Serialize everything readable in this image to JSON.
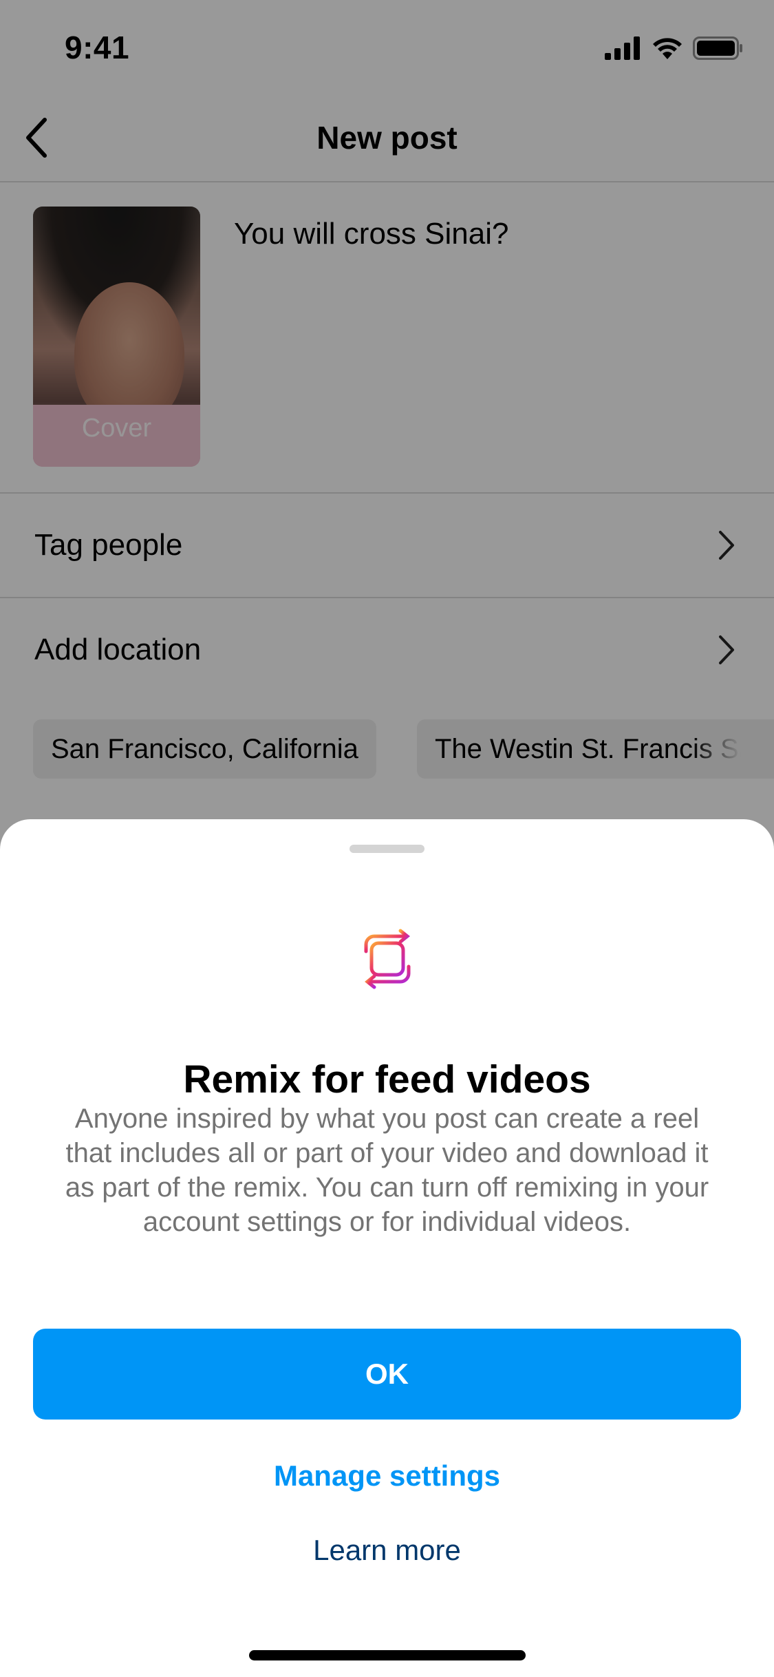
{
  "status_bar": {
    "time": "9:41",
    "icons": [
      "cellular-signal-icon",
      "wifi-icon",
      "battery-icon"
    ]
  },
  "header": {
    "back_icon": "chevron-left-icon",
    "title": "New post"
  },
  "post": {
    "cover_label": "Cover",
    "caption": "You will cross Sinai?"
  },
  "options": [
    {
      "label": "Tag people",
      "icon": "chevron-right-icon"
    },
    {
      "label": "Add location",
      "icon": "chevron-right-icon"
    }
  ],
  "location_suggestions": [
    "San Francisco, California",
    "The Westin St. Francis San Francisco"
  ],
  "sheet": {
    "icon": "remix-icon",
    "title": "Remix for feed videos",
    "body": "Anyone inspired by what you post can create a reel that includes all or part of your video and download it as part of the remix. You can turn off remixing in your account settings or for individual videos.",
    "ok_label": "OK",
    "manage_label": "Manage settings",
    "learn_label": "Learn more"
  },
  "colors": {
    "primary_button": "#0095f6",
    "link_primary": "#0095f6",
    "link_secondary": "#00376b",
    "overlay": "rgba(0,0,0,0.4)"
  }
}
